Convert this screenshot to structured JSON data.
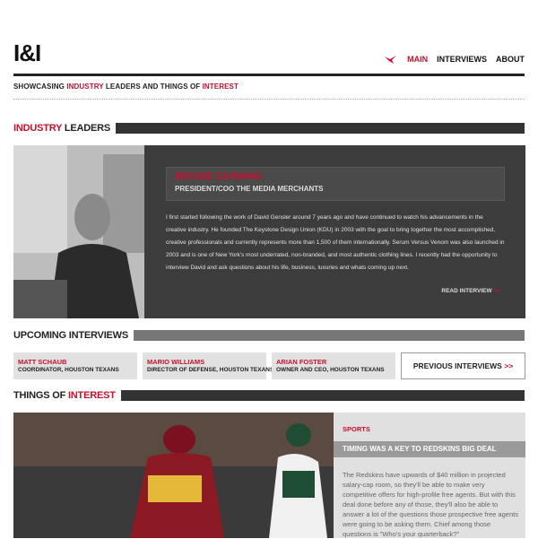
{
  "header": {
    "logo": "I&I",
    "nav": [
      {
        "label": "MAIN"
      },
      {
        "label": "INTERVIEWS"
      },
      {
        "label": "ABOUT"
      }
    ],
    "tagline": {
      "part1": "SHOWCASING ",
      "accent1": "INDUSTRY",
      "part2": " LEADERS AND THINGS OF ",
      "accent2": "INTEREST"
    }
  },
  "industry_leaders": {
    "heading_accent": "INDUSTRY",
    "heading_rest": " LEADERS",
    "name": "BRODIE GUNNING",
    "title": "PRESIDENT/COO THE MEDIA MERCHANTS",
    "bio": "I first started following the work of David Gensler around 7 years ago and have continued to watch his advancements in the creative industry. He founded The Keystone Design Union (KDU) in 2003 with the goal to bring together the most accomplished, creative professionals and currently represents more than 1,500 of them internationally. Serum Versus Venom was also launched in 2003 and is one of New York's most underrated, non-branded, and most authentic clothing lines. I recently had the opportunity to interview David and ask questions about his life, business, luxuries and whats coming up next.",
    "read_more": "READ INTERVIEW",
    "read_more_arrow": ">>"
  },
  "upcoming": {
    "heading": "UPCOMING INTERVIEWS",
    "items": [
      {
        "name": "MATT SCHAUB",
        "title": "COORDINATOR, HOUSTON TEXANS"
      },
      {
        "name": "MARIO WILLIAMS",
        "title": "DIRECTOR OF DEFENSE, HOUSTON TEXANS"
      },
      {
        "name": "ARIAN FOSTER",
        "title": "OWNER AND CEO, HOUSTON TEXANS"
      }
    ],
    "previous_label": "PREVIOUS INTERVIEWS",
    "previous_arrow": ">>"
  },
  "things": {
    "heading_rest": "THINGS OF ",
    "heading_accent": "INTEREST",
    "category": "SPORTS",
    "headline": "TIMING WAS A KEY TO REDSKINS BIG DEAL",
    "summary": "The Redskins have upwards of $40 million in projected salary-cap room, so they'll be able to make very competitive offers for high-profile free agents. But with this deal done before any of those, they'll also be able to answer a lot of the questions those prospective free agents were going to be asking them. Chief among those questions is \"Who's your quarterback?\""
  },
  "colors": {
    "accent": "#c8102e",
    "dark": "#333333",
    "panel": "#3c3c3c"
  }
}
